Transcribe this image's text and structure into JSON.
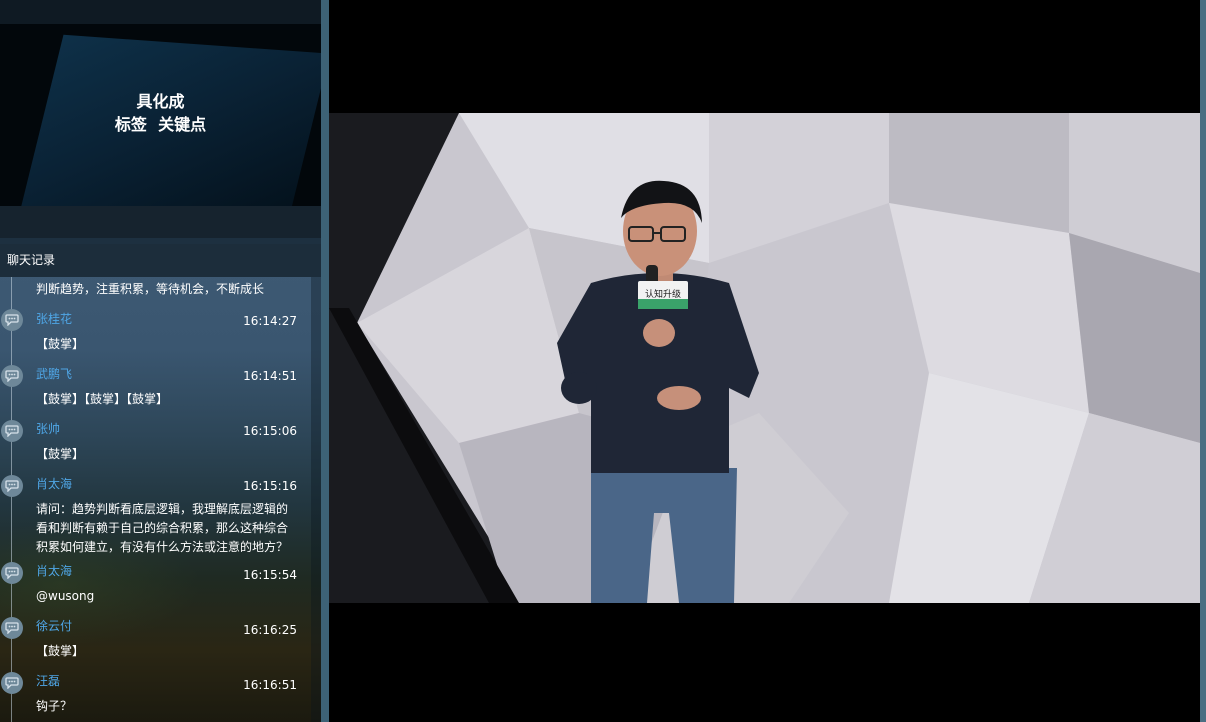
{
  "slide": {
    "line1": "具化成",
    "line2": "标签  关键点"
  },
  "chat": {
    "header": "聊天记录",
    "messages": [
      {
        "text": "判断趋势，注重积累，等待机会，不断成长"
      },
      {
        "name": "张桂花",
        "time": "16:14:27",
        "text": "【鼓掌】"
      },
      {
        "name": "武鹏飞",
        "time": "16:14:51",
        "text": "【鼓掌】【鼓掌】【鼓掌】"
      },
      {
        "name": "张帅",
        "time": "16:15:06",
        "text": "【鼓掌】"
      },
      {
        "name": "肖太海",
        "time": "16:15:16",
        "text": "请问：趋势判断看底层逻辑，我理解底层逻辑的\n看和判断有赖于自己的综合积累，那么这种综合\n积累如何建立，有没有什么方法或注意的地方？"
      },
      {
        "name": "肖太海",
        "time": "16:15:54",
        "text": "@wusong"
      },
      {
        "name": "徐云付",
        "time": "16:16:25",
        "text": "【鼓掌】"
      },
      {
        "name": "汪磊",
        "time": "16:16:51",
        "text": "钩子？"
      }
    ]
  },
  "video": {
    "mic_label": "认知升级",
    "icons": {
      "chat_avatar": "chat-bubble-icon"
    }
  }
}
